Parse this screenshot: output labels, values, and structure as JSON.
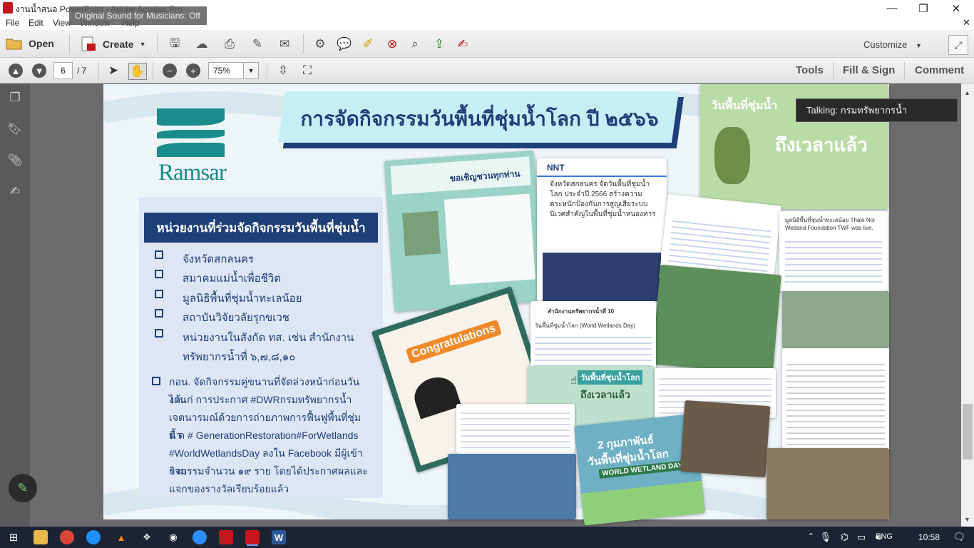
{
  "window": {
    "title": "งานน้ำสนอ PowerPoint - Adobe Acrobat Pro",
    "sound_tooltip": "Original Sound for Musicians: Off",
    "controls": {
      "minimize": "—",
      "maximize": "❐",
      "close": "✕",
      "doc_close": "✕"
    }
  },
  "menubar": {
    "items": [
      "File",
      "Edit",
      "View",
      "Window",
      "Help"
    ]
  },
  "toolbar": {
    "open_label": "Open",
    "create_label": "Create",
    "customize_label": "Customize",
    "icons": [
      "save-icon",
      "cloud-upload-icon",
      "print-icon",
      "edit-doc-icon",
      "mail-icon",
      "gear-icon",
      "comment-bubble-icon",
      "highlight-icon",
      "delete-page-icon",
      "search-doc-icon",
      "export-icon",
      "sign-icon"
    ]
  },
  "nav_toolbar": {
    "page_current": "6",
    "page_total": "/ 7",
    "zoom": "75%",
    "tools_label": "Tools",
    "fill_sign_label": "Fill & Sign",
    "comment_label": "Comment"
  },
  "slide": {
    "logo_text": "Ramsar",
    "title": "การจัดกิจกรรมวันพื้นที่ชุ่มน้ำโลก ปี ๒๕๖๖",
    "org_heading": "หน่วยงานที่ร่วมจัดกิจกรรมวันพื้นที่ชุ่มน้ำ",
    "orgs": [
      "จังหวัดสกลนคร",
      "สมาคมแม่น้ำเพื่อชีวิต",
      "มูลนิธิพื้นที่ชุ่มน้ำทะเลน้อย",
      "สถาบันวิจัยวลัยรุกขเวช",
      "หน่วยงานในสังกัด ทส. เช่น สำนักงาน"
    ],
    "org_continued": "ทรัพยากรน้ำที่ ๖,๗,๘,๑๐",
    "paragraph": [
      "กอน. จัดกิจกรรมคู่ขนานที่จัดล่วงหน้าก่อนวันงาน",
      "ได้แก่ การประกาศ #DWRกรมทรัพยากรน้ำ",
      "เจตนารมณ์ด้วยการถ่ายภาพการฟื้นฟูพื้นที่ชุ่มน้ำ",
      "ติ ด # GenerationRestoration#ForWetlands",
      "#WorldWetlandsDay ลงใน Facebook มีผู้เข้าร่วม",
      "กิจกรรมจำนวน ๑๙ ราย โดยได้ประกาศผลและ",
      "แจกของรางวัลเรียบร้อยแล้ว"
    ],
    "collage": {
      "invite_title": "ขอเชิญชวนทุกท่าน",
      "nnt_brand": "NNT",
      "nnt_headline": "จังหวัดสกลนคร จัดวันพื้นที่ชุ่มน้ำโลก ประจำปี 2566 สร้างความตระหนักป้องกันการสูญเสียระบบนิเวศสำคัญในพื้นที่ชุ่มน้ำหนองหาร",
      "poster_title": "วันพื้นที่ชุ่มน้ำ",
      "poster_sub": "ถึงเวลาแล้ว",
      "congrats": "Congratulations",
      "wetland_day_date": "2 กุมภาพันธ์",
      "wetland_day_th": "วันพื้นที่ชุ่มน้ำโลก",
      "wetland_day_en": "WORLD WETLAND DAY",
      "mid_banner": "วันพื้นที่ชุ่มน้ำโลก",
      "mid_sub": "ถึงเวลาแล้ว",
      "fb_post_page": "สำนักงานทรัพยากรน้ำที่ 10",
      "fb_post_line": "วันพื้นที่ชุ่มน้ำโลก (World Wetlands Day)",
      "fb_foundation": "มูลนิธิพื้นที่ชุ่มน้ำทะเลน้อย Thale Noi Wetland Foundation TWF was live."
    }
  },
  "talking_tooltip": "Talking: กรมทรัพยากรน้ำ",
  "taskbar": {
    "lang": "ENG",
    "time": "10:58"
  }
}
